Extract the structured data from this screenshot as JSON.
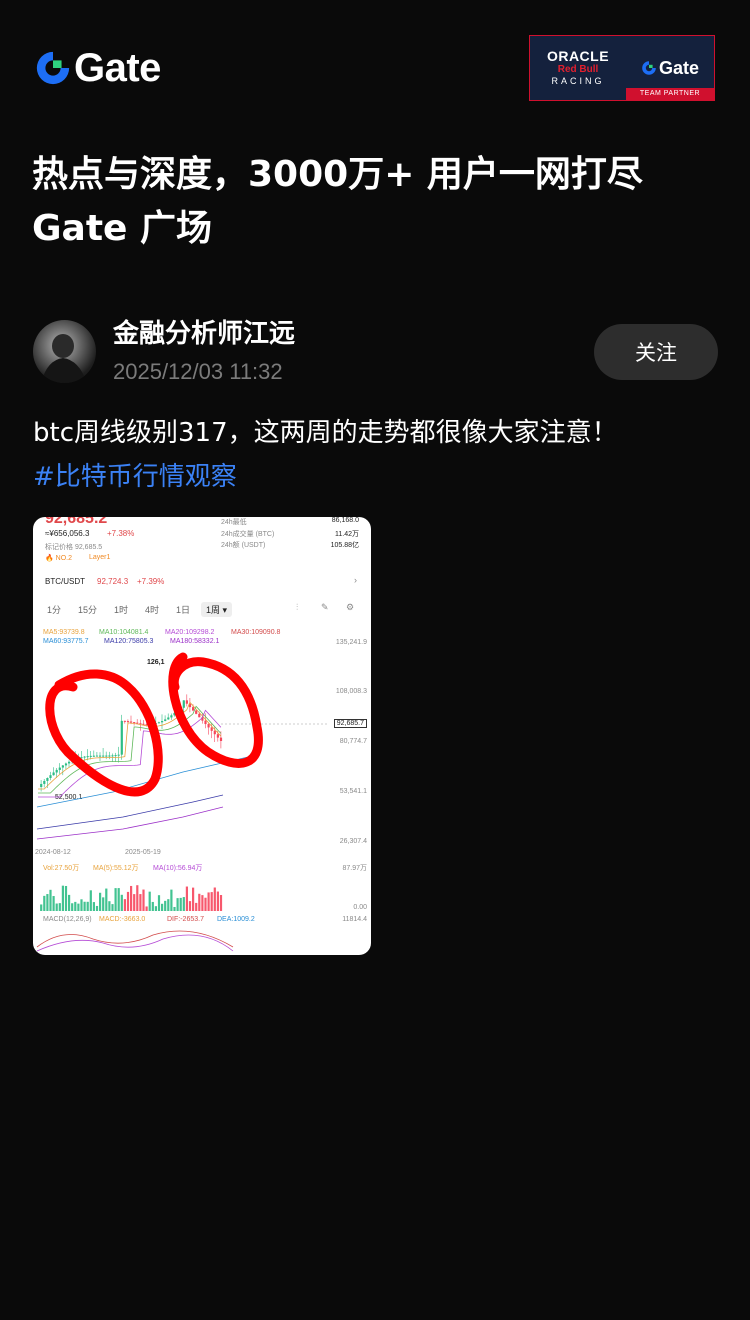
{
  "header": {
    "brand": "Gate",
    "partner": {
      "oracle": "ORACLE",
      "redbull": "Red Bull",
      "racing": "RACING",
      "gate": "Gate",
      "team_partner": "TEAM PARTNER"
    }
  },
  "headline": {
    "line1": "热点与深度，3000万+ 用户一网打尽",
    "line2": "Gate 广场"
  },
  "post": {
    "author": "金融分析师江远",
    "time": "2025/12/03 11:32",
    "follow_label": "关注",
    "text": "btc周线级别317，这两周的走势都很像大家注意！",
    "hashtag": "#比特币行情观察"
  },
  "chart_image": {
    "top_price": "92,685.2",
    "cny_price": "≈¥656,056.3",
    "change": "+7.38%",
    "mark_price_label": "标记价格 92,685.5",
    "rank": "NO.2",
    "sector": "Layer1",
    "stats": [
      {
        "label": "24h最低",
        "value": "86,168.0"
      },
      {
        "label": "24h成交量 (BTC)",
        "value": "11.42万"
      },
      {
        "label": "24h额 (USDT)",
        "value": "105.88亿"
      }
    ],
    "pair": "BTC/USDT",
    "pair_price": "92,724.3",
    "pair_change": "+7.39%",
    "timeframes": [
      "1分",
      "15分",
      "1时",
      "4时",
      "1日",
      "1周"
    ],
    "active_timeframe": "1周",
    "ma_line1": [
      "MA5:93739.8",
      "MA10:104081.4",
      "MA20:109298.2",
      "MA30:109090.8"
    ],
    "ma_line2": [
      "MA60:93775.7",
      "MA120:75805.3",
      "MA180:58332.1"
    ],
    "y_ticks": [
      "135,241.9",
      "108,008.3",
      "80,774.7",
      "53,541.1",
      "26,307.4"
    ],
    "current_price_tag": "92,685.7",
    "high_label": "126,1",
    "low_label": "52,500.1",
    "x_dates": [
      "2024-08-12",
      "2025-05-19"
    ],
    "vol_line": [
      "Vol:27.50万",
      "MA(5):55.12万",
      "MA(10):56.94万"
    ],
    "vol_ticks": [
      "87.97万",
      "0.00"
    ],
    "macd_line": [
      "MACD(12,26,9)",
      "MACD:-3663.0",
      "DIF:-2653.7",
      "DEA:1009.2"
    ],
    "macd_tick": "11814.4",
    "colors": {
      "up": "#2ebd85",
      "down": "#f6465d",
      "annotation": "#ff0000"
    }
  }
}
